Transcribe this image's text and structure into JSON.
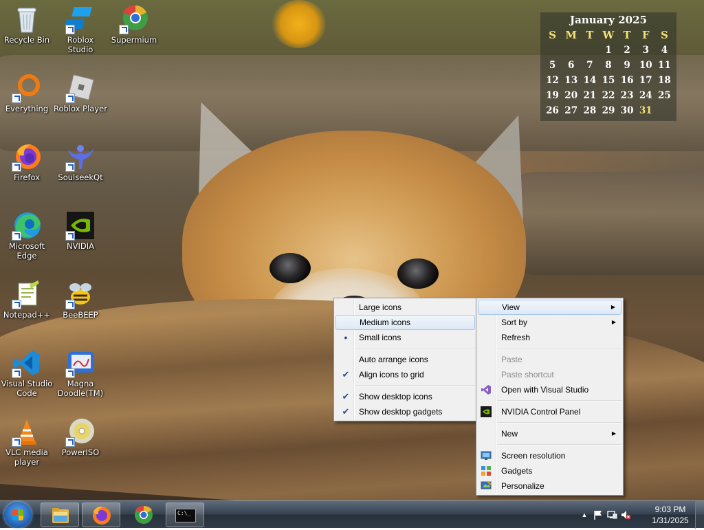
{
  "desktop_icons": [
    {
      "label": "Recycle Bin",
      "icon": "recycle-bin-icon",
      "shortcut": false
    },
    {
      "label": "Roblox Studio",
      "icon": "roblox-studio-icon",
      "shortcut": true
    },
    {
      "label": "Supermium",
      "icon": "supermium-icon",
      "shortcut": true
    },
    {
      "label": "Everything",
      "icon": "everything-icon",
      "shortcut": true
    },
    {
      "label": "Roblox Player",
      "icon": "roblox-player-icon",
      "shortcut": true
    },
    {
      "label": "Firefox",
      "icon": "firefox-icon",
      "shortcut": true
    },
    {
      "label": "SoulseekQt",
      "icon": "soulseekqt-icon",
      "shortcut": true
    },
    {
      "label": "Microsoft Edge",
      "icon": "edge-icon",
      "shortcut": true
    },
    {
      "label": "NVIDIA",
      "icon": "nvidia-icon",
      "shortcut": true
    },
    {
      "label": "Notepad++",
      "icon": "notepadpp-icon",
      "shortcut": true
    },
    {
      "label": "BeeBEEP",
      "icon": "beebeep-icon",
      "shortcut": true
    },
    {
      "label": "Visual Studio Code",
      "icon": "vscode-icon",
      "shortcut": true
    },
    {
      "label": "Magna Doodle(TM)",
      "icon": "magna-doodle-icon",
      "shortcut": true
    },
    {
      "label": "VLC media player",
      "icon": "vlc-icon",
      "shortcut": true
    },
    {
      "label": "PowerISO",
      "icon": "poweriso-icon",
      "shortcut": true
    }
  ],
  "calendar": {
    "title": "January 2025",
    "weekdays": [
      "S",
      "M",
      "T",
      "W",
      "T",
      "F",
      "S"
    ],
    "weeks": [
      [
        "",
        "",
        "",
        "1",
        "2",
        "3",
        "4"
      ],
      [
        "5",
        "6",
        "7",
        "8",
        "9",
        "10",
        "11"
      ],
      [
        "12",
        "13",
        "14",
        "15",
        "16",
        "17",
        "18"
      ],
      [
        "19",
        "20",
        "21",
        "22",
        "23",
        "24",
        "25"
      ],
      [
        "26",
        "27",
        "28",
        "29",
        "30",
        "31",
        ""
      ]
    ],
    "today": "31"
  },
  "context_menu": {
    "items": [
      {
        "label": "View",
        "submenu": true,
        "highlighted": true
      },
      {
        "label": "Sort by",
        "submenu": true
      },
      {
        "label": "Refresh"
      },
      {
        "sep": true
      },
      {
        "label": "Paste",
        "disabled": true
      },
      {
        "label": "Paste shortcut",
        "disabled": true
      },
      {
        "label": "Open with Visual Studio",
        "icon": "visual-studio-icon"
      },
      {
        "sep": true
      },
      {
        "label": "NVIDIA Control Panel",
        "icon": "nvidia-control-panel-icon"
      },
      {
        "sep": true
      },
      {
        "label": "New",
        "submenu": true
      },
      {
        "sep": true
      },
      {
        "label": "Screen resolution",
        "icon": "screen-resolution-icon"
      },
      {
        "label": "Gadgets",
        "icon": "gadgets-icon"
      },
      {
        "label": "Personalize",
        "icon": "personalize-icon"
      }
    ]
  },
  "view_submenu": {
    "items": [
      {
        "label": "Large icons"
      },
      {
        "label": "Medium icons",
        "highlighted": true
      },
      {
        "label": "Small icons",
        "mark": "bullet"
      },
      {
        "sep": true
      },
      {
        "label": "Auto arrange icons"
      },
      {
        "label": "Align icons to grid",
        "mark": "check"
      },
      {
        "sep": true
      },
      {
        "label": "Show desktop icons",
        "mark": "check"
      },
      {
        "label": "Show desktop gadgets",
        "mark": "check"
      }
    ]
  },
  "taskbar": {
    "buttons": [
      {
        "name": "file-explorer-icon",
        "pinned": true
      },
      {
        "name": "firefox-icon",
        "pinned": true
      },
      {
        "name": "supermium-icon",
        "pinned": false
      },
      {
        "name": "command-prompt-icon",
        "pinned": true
      }
    ],
    "cmd_glyph": "C:\\_",
    "tray": {
      "show_hidden": "▲",
      "time": "9:03 PM",
      "date": "1/31/2025"
    }
  }
}
